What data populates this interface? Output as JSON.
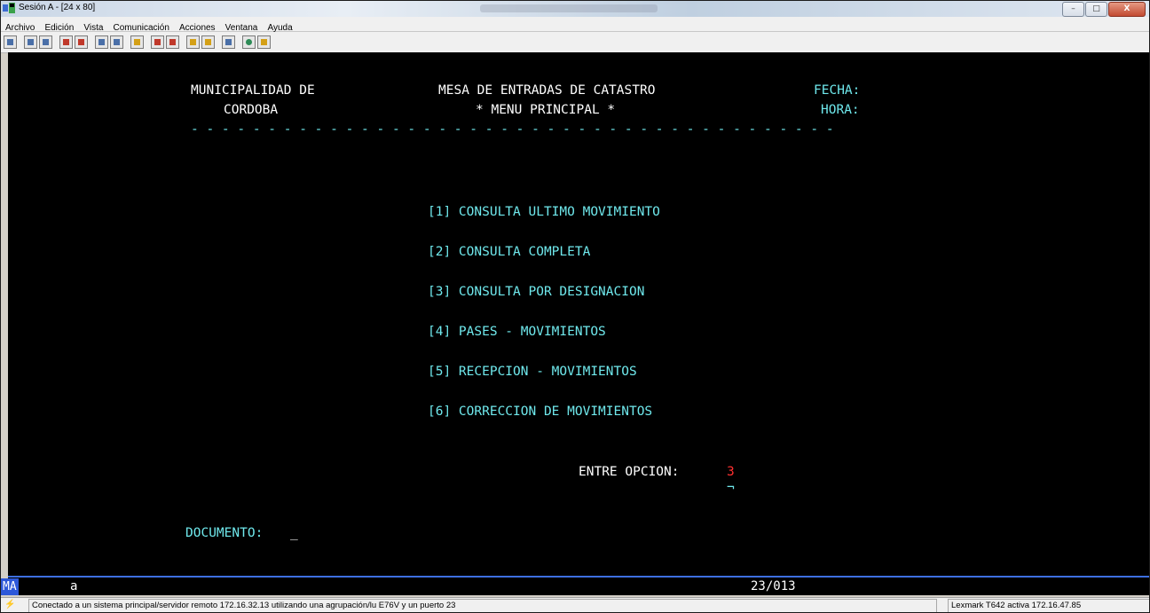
{
  "window": {
    "title": "Sesión A - [24 x 80]",
    "minimize_label": "–",
    "maximize_label": "□",
    "close_label": "X"
  },
  "menu": {
    "items": [
      "Archivo",
      "Edición",
      "Vista",
      "Comunicación",
      "Acciones",
      "Ventana",
      "Ayuda"
    ]
  },
  "toolbar": {
    "buttons": [
      "print-screen-icon",
      "copy-icon",
      "paste-icon",
      "send-icon",
      "receive-icon",
      "display-icon",
      "display-alt-icon",
      "macro-icon",
      "record-macro-icon",
      "stop-macro-icon",
      "play-macro-icon",
      "run-macro-icon",
      "clipboard-icon",
      "globe-icon",
      "edit-icon"
    ]
  },
  "terminal": {
    "header_left_1": "MUNICIPALIDAD DE",
    "header_left_2": "CORDOBA",
    "header_center_1": "MESA DE ENTRADAS DE CATASTRO",
    "header_center_2": "* MENU PRINCIPAL *",
    "header_right_1": "FECHA:",
    "header_right_2": "HORA:",
    "separator": "- - - - - - - - - - - - - - - - - - - - - - - - - - - - - - - - - - - - - - - - - -",
    "options": [
      "[1] CONSULTA ULTIMO MOVIMIENTO",
      "[2] CONSULTA COMPLETA",
      "[3] CONSULTA POR DESIGNACION",
      "[4] PASES - MOVIMIENTOS",
      "[5] RECEPCION - MOVIMIENTOS",
      "[6] CORRECCION DE MOVIMIENTOS"
    ],
    "prompt_label": "ENTRE OPCION:",
    "prompt_value": "3",
    "prompt_cursor": "¬",
    "document_label": "DOCUMENTO:",
    "document_value": "_"
  },
  "oia": {
    "indicator": "MA",
    "session_letter": "a",
    "cursor_position": "23/013"
  },
  "status": {
    "message": "Conectado a un sistema principal/servidor remoto 172.16.32.13 utilizando una agrupación/lu E76V y un puerto 23",
    "printer": "Lexmark T642 activa 172.16.47.85"
  },
  "colors": {
    "terminal_background": "#000000",
    "terminal_text": "#ffffff",
    "option_text": "#6fe8ec",
    "prompt_value": "#ff3030",
    "oia_indicator": "#2d58d9"
  }
}
